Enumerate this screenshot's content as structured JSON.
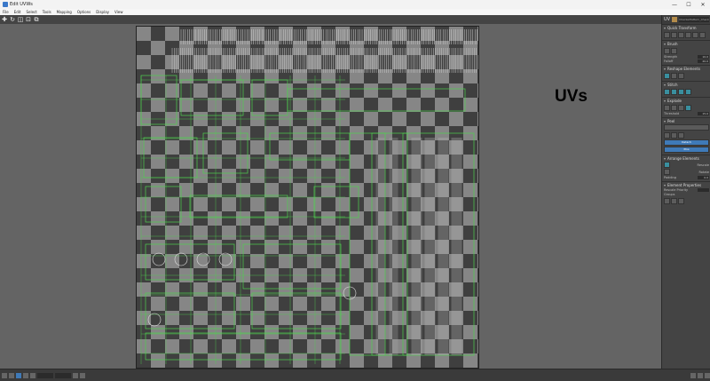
{
  "window": {
    "title": "Edit UVWs",
    "controls": [
      "—",
      "☐",
      "✕"
    ]
  },
  "menu": [
    "File",
    "Edit",
    "Select",
    "Tools",
    "Mapping",
    "Options",
    "Display",
    "View"
  ],
  "toolbar": {
    "channel": "UV",
    "object_name": "CheckerPattern_Checker"
  },
  "annotation": "UVs",
  "panel": {
    "sections": [
      {
        "key": "quick",
        "title": "Quick Transform"
      },
      {
        "key": "brush",
        "title": "Brush",
        "rows": [
          {
            "label": "Strength",
            "value": "10.0"
          },
          {
            "label": "Falloff",
            "value": "20.0"
          }
        ]
      },
      {
        "key": "reshape",
        "title": "Reshape Elements"
      },
      {
        "key": "stitch",
        "title": "Stitch"
      },
      {
        "key": "explode",
        "title": "Explode",
        "rows": [
          {
            "label": "Threshold",
            "value": "15.0"
          }
        ]
      },
      {
        "key": "peel",
        "title": "Peel",
        "buttons": [
          "Detach",
          "Pins"
        ]
      },
      {
        "key": "arrange",
        "title": "Arrange Elements",
        "checks": [
          "Rescale",
          "Rotate"
        ],
        "rows": [
          {
            "label": "Padding",
            "value": "0.0"
          }
        ]
      },
      {
        "key": "props",
        "title": "Element Properties",
        "rows": [
          {
            "label": "Rescale Priority",
            "value": ""
          },
          {
            "label": "Groups",
            "value": ""
          }
        ]
      }
    ]
  },
  "colors": {
    "checker_dark": "#3f3f3f",
    "checker_light": "#868686",
    "uv_edge": "#4fd04f",
    "accent": "#3f7ab8"
  }
}
